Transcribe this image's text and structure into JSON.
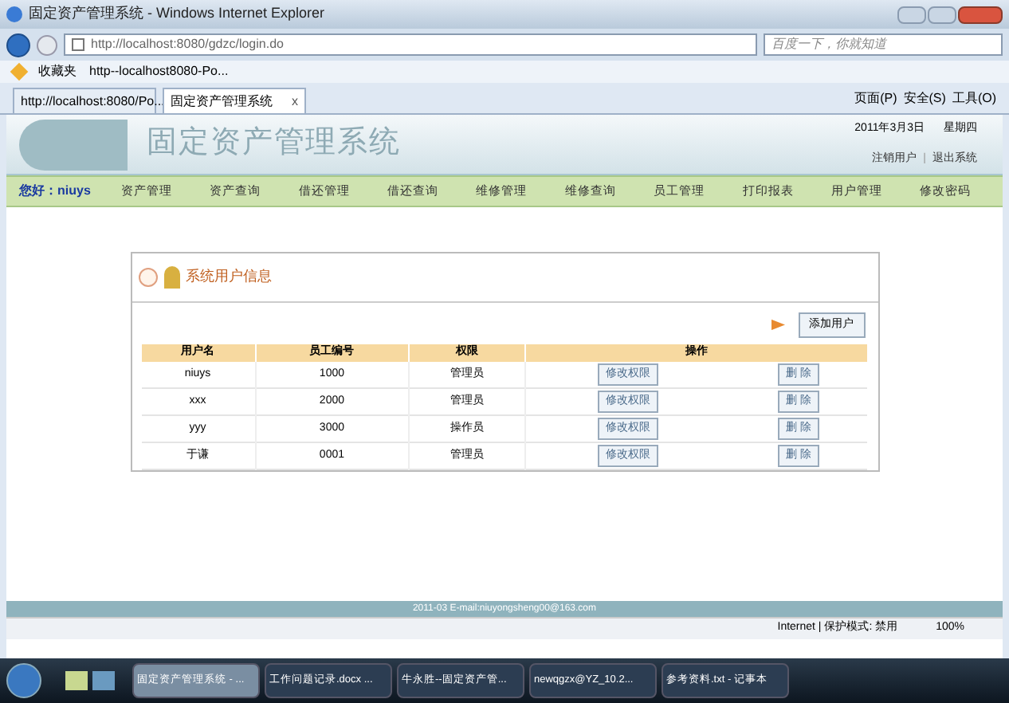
{
  "window": {
    "title": "固定资产管理系统 - Windows Internet Explorer"
  },
  "address_bar": {
    "url": "http://localhost:8080/gdzc/login.do",
    "search_placeholder": "百度一下，你就知道"
  },
  "favorites_bar": {
    "favorites_label": "收藏夹",
    "items": [
      "http--localhost8080-Po..."
    ]
  },
  "tabs": [
    {
      "label": "http://localhost:8080/Po...",
      "selected": false
    },
    {
      "label": "固定资产管理系统",
      "selected": true,
      "close": "x"
    }
  ],
  "command_bar": [
    "页面(P)",
    "安全(S)",
    "工具(O)"
  ],
  "page": {
    "app_title": "固定资产管理系统",
    "date": "2011年3月3日",
    "weekday": "星期四",
    "header_links": [
      "注销用户",
      "退出系统"
    ],
    "link_separator": "|",
    "greeting": "您好：niuys",
    "nav": [
      {
        "label": "资产管理"
      },
      {
        "label": "资产查询"
      },
      {
        "label": "借还管理"
      },
      {
        "label": "借还查询"
      },
      {
        "label": "维修管理"
      },
      {
        "label": "维修查询"
      },
      {
        "label": "员工管理"
      },
      {
        "label": "打印报表"
      },
      {
        "label": "用户管理"
      },
      {
        "label": "修改密码"
      }
    ],
    "panel": {
      "title": "系统用户信息",
      "add_button": "添加用户",
      "table": {
        "columns": [
          "用户名",
          "员工编号",
          "权限",
          "操作"
        ],
        "rows": [
          {
            "cells": [
              "niuys",
              "1000",
              "管理员"
            ],
            "actions": [
              "修改权限",
              "删 除"
            ]
          },
          {
            "cells": [
              "xxx",
              "2000",
              "管理员"
            ],
            "actions": [
              "修改权限",
              "删 除"
            ]
          },
          {
            "cells": [
              "yyy",
              "3000",
              "操作员"
            ],
            "actions": [
              "修改权限",
              "删 除"
            ]
          },
          {
            "cells": [
              "于谦",
              "0001",
              "管理员"
            ],
            "actions": [
              "修改权限",
              "删 除"
            ]
          }
        ]
      }
    },
    "footer": "2011-03 E-mail:niuyongsheng00@163.com"
  },
  "status_bar": {
    "zone": "Internet | 保护模式: 禁用",
    "zoom": "100%"
  },
  "taskbar": [
    {
      "label": "固定资产管理系统 - ...",
      "selected": true
    },
    {
      "label": "工作问题记录.docx ...",
      "selected": false
    },
    {
      "label": "牛永胜--固定资产管...",
      "selected": false
    },
    {
      "label": "newqgzx@YZ_10.2...",
      "selected": false
    },
    {
      "label": "参考资料.txt - 记事本",
      "selected": false
    }
  ]
}
